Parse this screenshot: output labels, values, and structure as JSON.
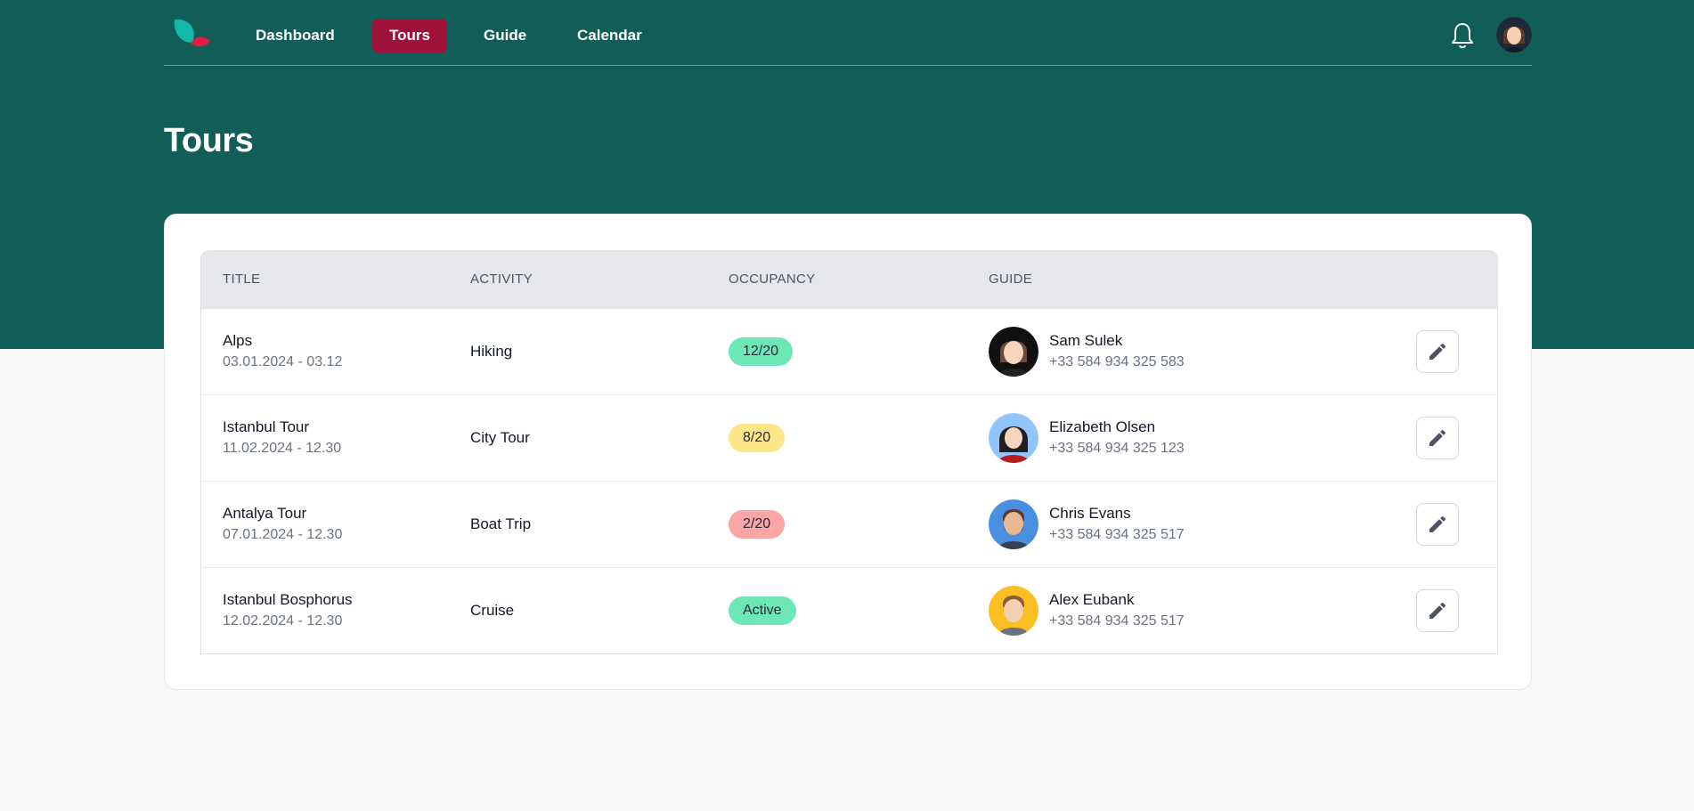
{
  "nav": {
    "items": [
      {
        "label": "Dashboard",
        "active": false
      },
      {
        "label": "Tours",
        "active": true
      },
      {
        "label": "Guide",
        "active": false
      },
      {
        "label": "Calendar",
        "active": false
      }
    ]
  },
  "page": {
    "title": "Tours"
  },
  "table": {
    "headers": [
      "TITLE",
      "ACTIVITY",
      "OCCUPANCY",
      "GUIDE"
    ],
    "rows": [
      {
        "title": "Alps",
        "dates": "03.01.2024 - 03.12",
        "activity": "Hiking",
        "occupancy": "12/20",
        "status": "green",
        "guide_name": "Sam Sulek",
        "guide_phone": "+33 584 934 325 583",
        "avatar_icon": "dark-hair-avatar-icon"
      },
      {
        "title": "Istanbul Tour",
        "dates": "11.02.2024 - 12.30",
        "activity": "City Tour",
        "occupancy": "8/20",
        "status": "yellow",
        "guide_name": "Elizabeth Olsen",
        "guide_phone": "+33 584 934 325 123",
        "avatar_icon": "woman-avatar-icon"
      },
      {
        "title": "Antalya Tour",
        "dates": "07.01.2024 - 12.30",
        "activity": "Boat Trip",
        "occupancy": "2/20",
        "status": "red",
        "guide_name": "Chris Evans",
        "guide_phone": "+33 584 934 325 517",
        "avatar_icon": "bearded-man-avatar-icon"
      },
      {
        "title": "Istanbul Bosphorus",
        "dates": "12.02.2024 - 12.30",
        "activity": "Cruise",
        "occupancy": "Active",
        "status": "green",
        "guide_name": "Alex Eubank",
        "guide_phone": "+33 584 934 325 517",
        "avatar_icon": "man-avatar-icon"
      }
    ]
  },
  "colors": {
    "header_bg": "#115e59",
    "active_nav": "#9f1239",
    "badge_green": "#6ee7b7",
    "badge_yellow": "#fde68a",
    "badge_red": "#fca5a5"
  },
  "icons": {
    "logo": "leaf-logo-icon",
    "bell": "bell-icon",
    "edit": "pencil-icon"
  }
}
